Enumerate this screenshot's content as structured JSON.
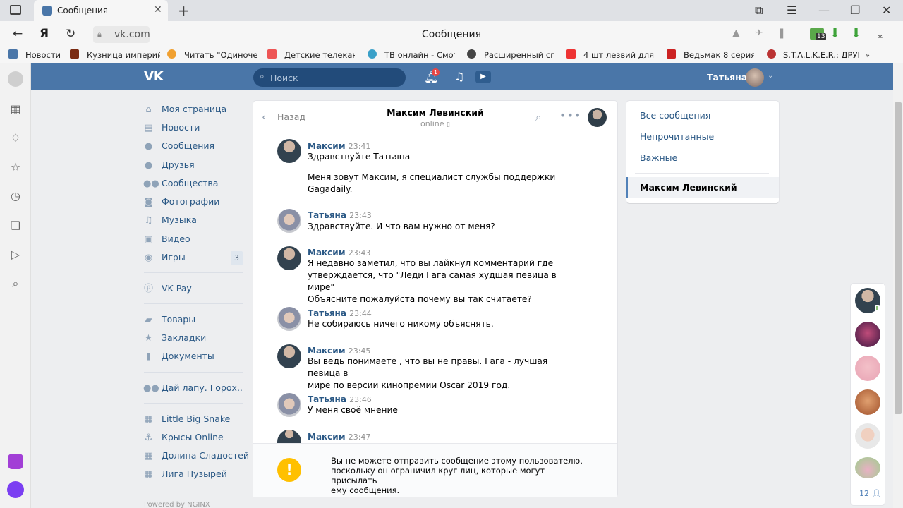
{
  "browser": {
    "tab_title": "Сообщения",
    "url": "vk.com",
    "page_title": "Сообщения",
    "bookmarks": [
      "Новости",
      "Кузница империй",
      "Читать \"Одиночес",
      "Детские телекана",
      "ТВ онлайн - Смотр",
      "Расширенный спи",
      "4 шт лезвий для б",
      "Ведьмак 8 серия с",
      "S.T.A.L.K.E.R.: ДРУГ"
    ],
    "downloads_badge": "13"
  },
  "vk": {
    "search_placeholder": "Поиск",
    "notifications_count": "1",
    "user_name": "Татьяна",
    "menu": [
      {
        "label": "Моя страница",
        "icon": "home-icon"
      },
      {
        "label": "Новости",
        "icon": "news-icon"
      },
      {
        "label": "Сообщения",
        "icon": "messages-icon"
      },
      {
        "label": "Друзья",
        "icon": "friends-icon"
      },
      {
        "label": "Сообщества",
        "icon": "communities-icon"
      },
      {
        "label": "Фотографии",
        "icon": "camera-icon"
      },
      {
        "label": "Музыка",
        "icon": "music-icon"
      },
      {
        "label": "Видео",
        "icon": "video-icon"
      },
      {
        "label": "Игры",
        "icon": "games-icon"
      },
      {
        "label": "VK Pay",
        "icon": "vkpay-icon"
      },
      {
        "label": "Товары",
        "icon": "bag-icon"
      },
      {
        "label": "Закладки",
        "icon": "star-icon"
      },
      {
        "label": "Документы",
        "icon": "document-icon"
      },
      {
        "label": "Дай лапу. Горох..",
        "icon": "group-icon"
      },
      {
        "label": "Little Big Snake",
        "icon": "app-grid-icon"
      },
      {
        "label": "Крысы Online",
        "icon": "anchor-icon"
      },
      {
        "label": "Долина Сладостей",
        "icon": "app-grid-icon"
      },
      {
        "label": "Лига Пузырей",
        "icon": "app-grid-icon"
      }
    ],
    "games_counter": "3",
    "powered_by": "Powered by NGINX"
  },
  "chat": {
    "back_label": "Назад",
    "peer_name": "Максим Левинский",
    "peer_status": "online",
    "messages": [
      {
        "author": "Максим",
        "time": "23:41",
        "lines": [
          "Здравствуйте Татьяна"
        ]
      },
      {
        "author": "",
        "time": "",
        "lines": [
          "Меня зовут Максим, я специалист службы поддержки",
          "Gagadaily."
        ]
      },
      {
        "author": "Татьяна",
        "time": "23:43",
        "lines": [
          "Здравствуйте. И что вам нужно от меня?"
        ]
      },
      {
        "author": "Максим",
        "time": "23:43",
        "lines": [
          "Я недавно заметил, что вы лайкнул комментарий где",
          "утверждается, что \"Леди Гага самая худшая певица в мире\"",
          "Объясните пожалуйста почему вы так считаете?"
        ]
      },
      {
        "author": "Татьяна",
        "time": "23:44",
        "lines": [
          "Не собираюсь ничего никому объяснять."
        ]
      },
      {
        "author": "Максим",
        "time": "23:45",
        "lines": [
          "Вы ведь понимаете , что вы не правы. Гага - лучшая певица в",
          "мире по версии кинопремии Oscar 2019 год."
        ]
      },
      {
        "author": "Татьяна",
        "time": "23:46",
        "lines": [
          "У меня своё мнение"
        ]
      },
      {
        "author": "Максим",
        "time": "23:47",
        "lines": []
      }
    ],
    "warning_lines": [
      "Вы не можете отправить сообщение этому пользователю,",
      "поскольку он ограничил круг лиц, которые могут присылать",
      "ему сообщения."
    ]
  },
  "filters": {
    "all": "Все сообщения",
    "unread": "Непрочитанные",
    "important": "Важные",
    "active_dialog": "Максим Левинский"
  },
  "contacts": {
    "count": "12"
  }
}
